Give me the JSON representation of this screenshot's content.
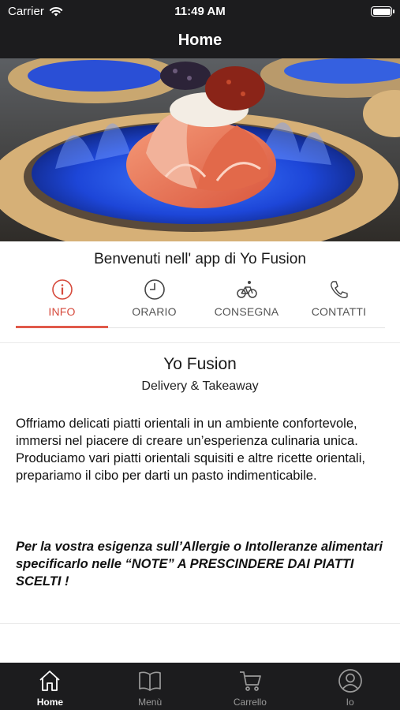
{
  "status_bar": {
    "carrier": "Carrier",
    "time": "11:49 AM"
  },
  "nav": {
    "title": "Home"
  },
  "hero": {
    "pages": 1,
    "current_page": 1,
    "accent": "#d12d2d"
  },
  "welcome": "Benvenuti nell' app di Yo Fusion",
  "tabs": [
    {
      "label": "INFO",
      "icon": "info-icon",
      "active": true
    },
    {
      "label": "ORARIO",
      "icon": "clock-icon",
      "active": false
    },
    {
      "label": "CONSEGNA",
      "icon": "bicycle-icon",
      "active": false
    },
    {
      "label": "CONTATTI",
      "icon": "phone-icon",
      "active": false
    }
  ],
  "content": {
    "name": "Yo Fusion",
    "subtitle": "Delivery & Takeaway",
    "description": "Offriamo delicati piatti orientali in un ambiente confortevole, immersi nel piacere di creare un’esperienza culinaria unica.\nProduciamo vari piatti orientali squisiti e altre ricette orientali, prepariamo il cibo per darti un pasto indimenticabile.",
    "note": "Per la vostra esigenza sull’Allergie o Intolleranze alimentari specificarlo nelle “NOTE” A PRESCINDERE DAI PIATTI SCELTI !"
  },
  "tab_bar": [
    {
      "label": "Home",
      "icon": "home-icon",
      "active": true
    },
    {
      "label": "Menù",
      "icon": "book-icon",
      "active": false
    },
    {
      "label": "Carrello",
      "icon": "cart-icon",
      "active": false
    },
    {
      "label": "Io",
      "icon": "user-icon",
      "active": false
    }
  ],
  "colors": {
    "accent": "#d64a3c",
    "bar_background": "#1c1c1e"
  }
}
